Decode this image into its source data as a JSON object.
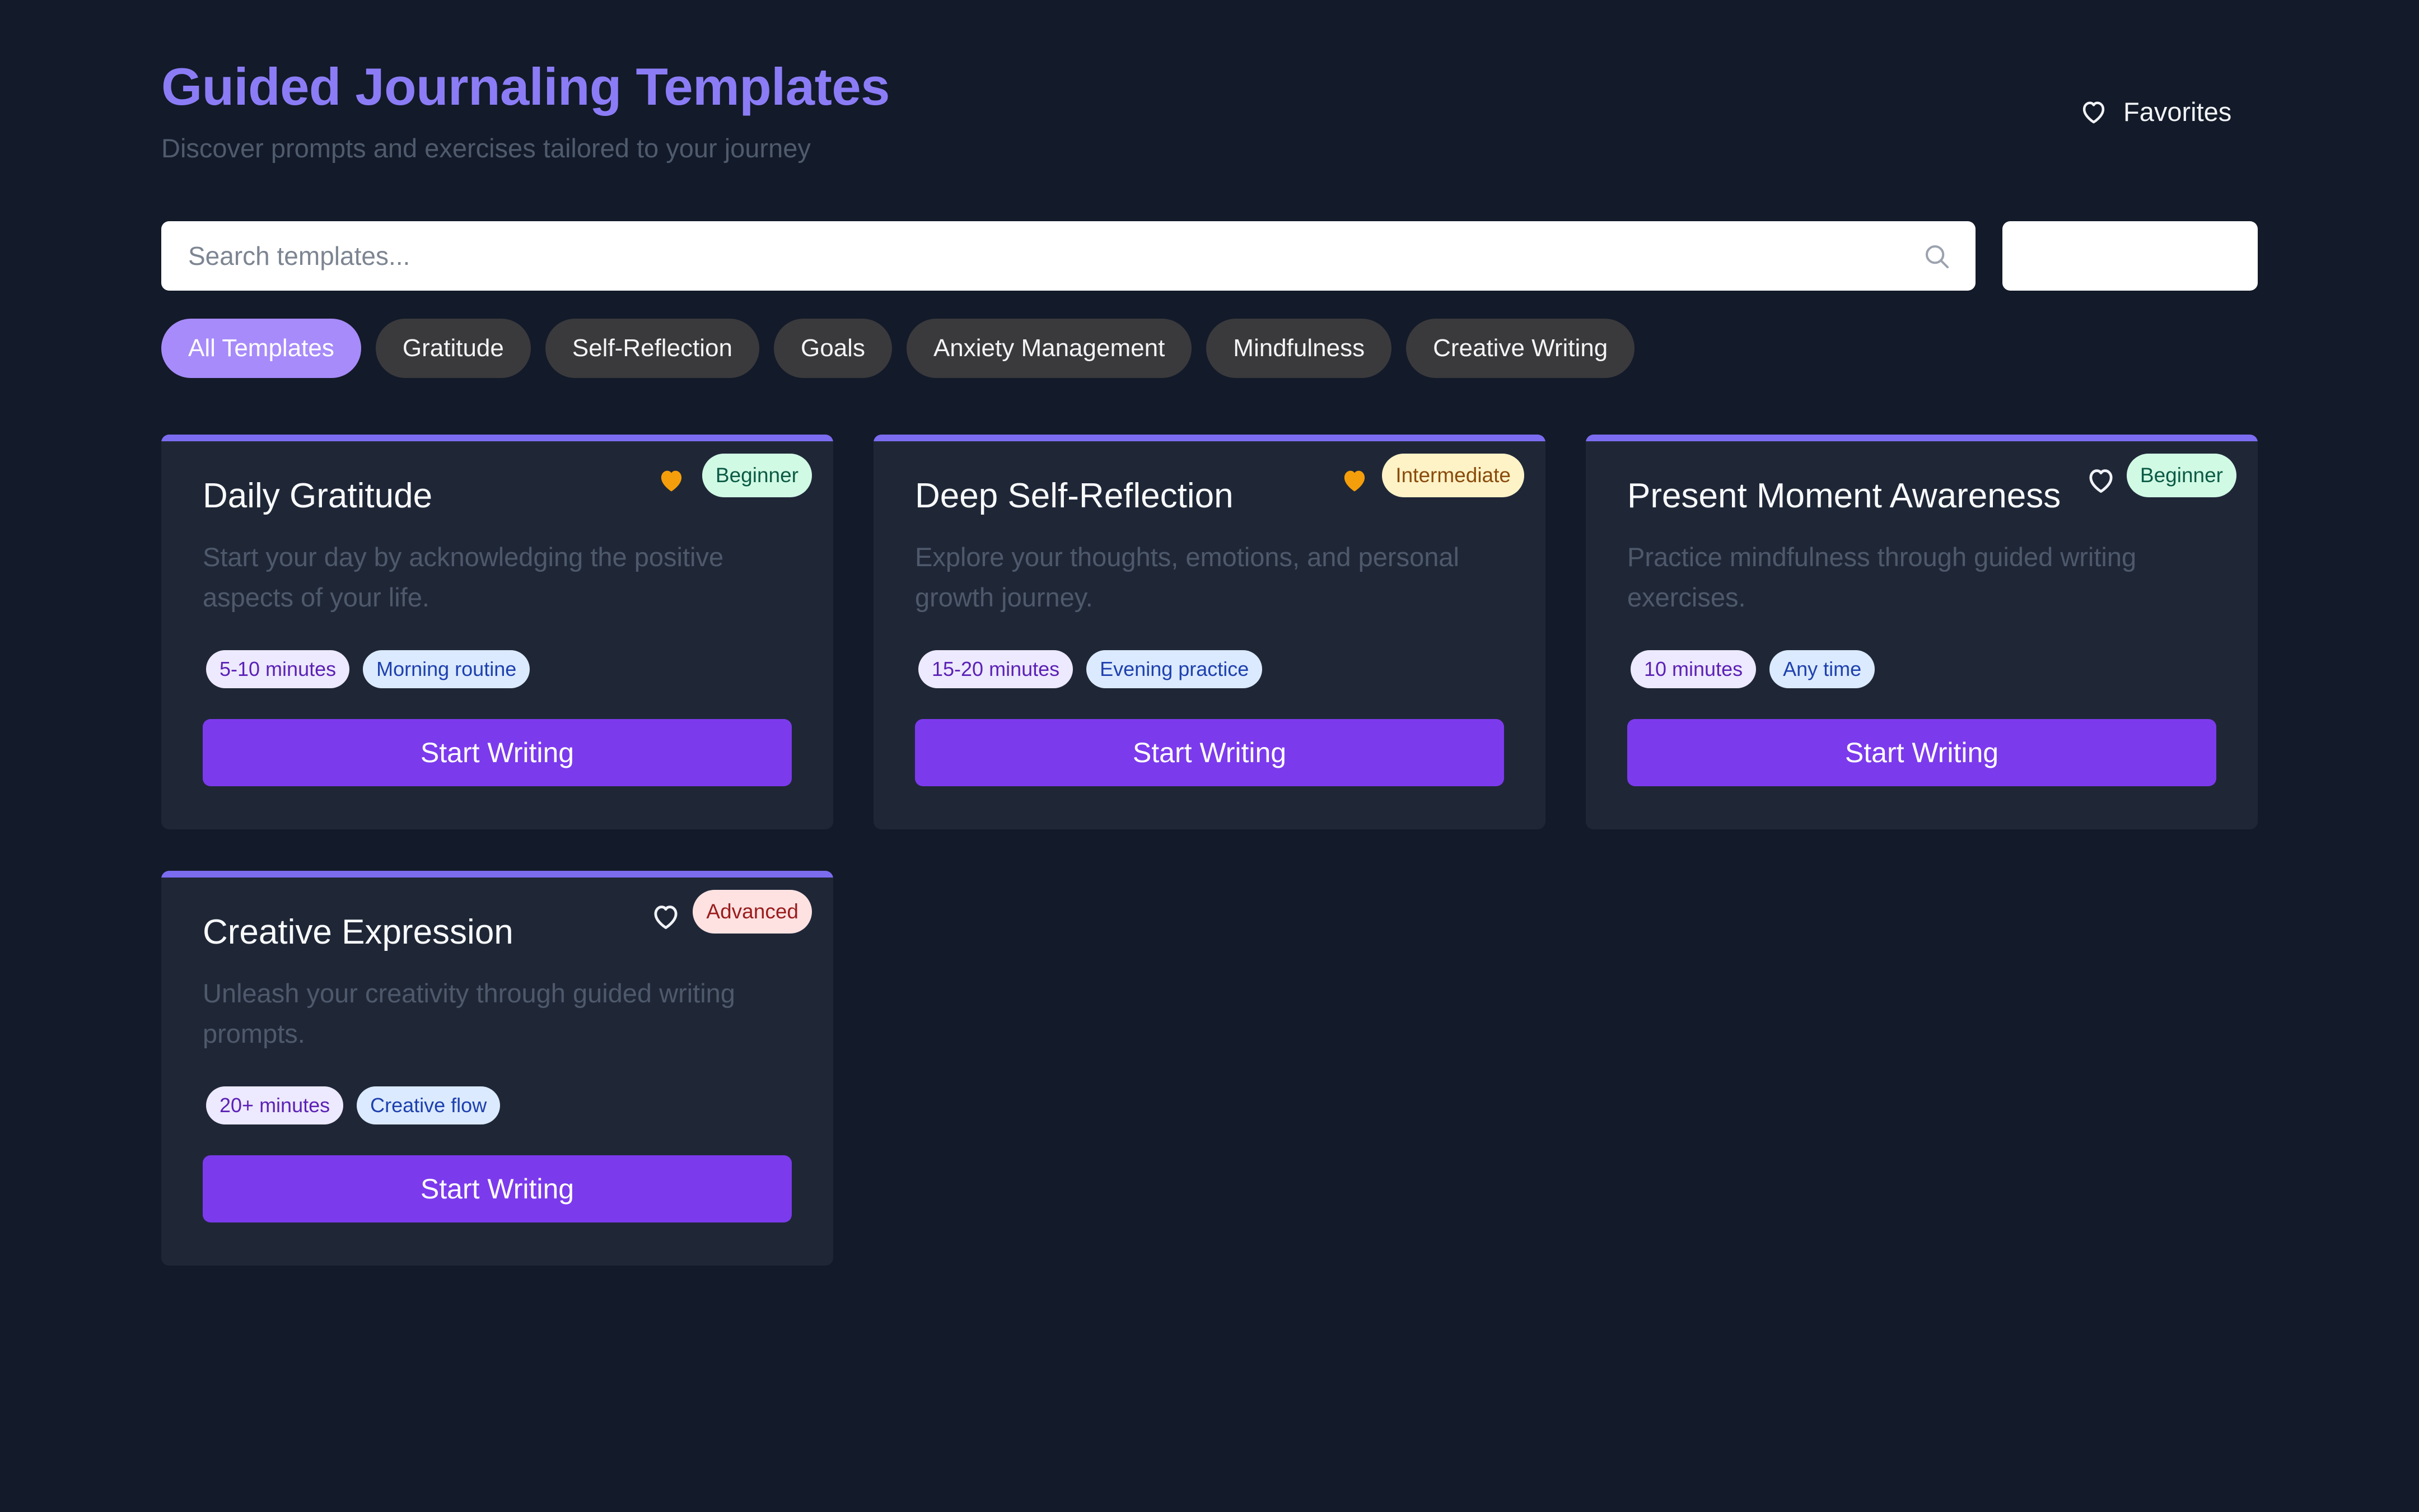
{
  "header": {
    "title": "Guided Journaling Templates",
    "subtitle": "Discover prompts and exercises tailored to your journey",
    "favorites_label": "Favorites",
    "favorites_icon": "heart-outline-icon"
  },
  "search": {
    "placeholder": "Search templates...",
    "value": "",
    "icon": "search-icon"
  },
  "sort": {
    "selected": ""
  },
  "categories": [
    {
      "label": "All Templates",
      "active": true
    },
    {
      "label": "Gratitude",
      "active": false
    },
    {
      "label": "Self-Reflection",
      "active": false
    },
    {
      "label": "Goals",
      "active": false
    },
    {
      "label": "Anxiety Management",
      "active": false
    },
    {
      "label": "Mindfulness",
      "active": false
    },
    {
      "label": "Creative Writing",
      "active": false
    }
  ],
  "cards": [
    {
      "title": "Daily Gratitude",
      "description": "Start your day by acknowledging the positive aspects of your life.",
      "level": "Beginner",
      "favorited": true,
      "duration": "5-10 minutes",
      "context": "Morning routine",
      "cta": "Start Writing"
    },
    {
      "title": "Deep Self-Reflection",
      "description": "Explore your thoughts, emotions, and personal growth journey.",
      "level": "Intermediate",
      "favorited": true,
      "duration": "15-20 minutes",
      "context": "Evening practice",
      "cta": "Start Writing"
    },
    {
      "title": "Present Moment Awareness",
      "description": "Practice mindfulness through guided writing exercises.",
      "level": "Beginner",
      "favorited": false,
      "duration": "10 minutes",
      "context": "Any time",
      "cta": "Start Writing"
    },
    {
      "title": "Creative Expression",
      "description": "Unleash your creativity through guided writing prompts.",
      "level": "Advanced",
      "favorited": false,
      "duration": "20+ minutes",
      "context": "Creative flow",
      "cta": "Start Writing"
    }
  ],
  "colors": {
    "background": "#131a29",
    "card": "#1f2737",
    "accent": "#7c3aed",
    "title": "#8b7cf6",
    "favorite": "#f59e0b"
  }
}
